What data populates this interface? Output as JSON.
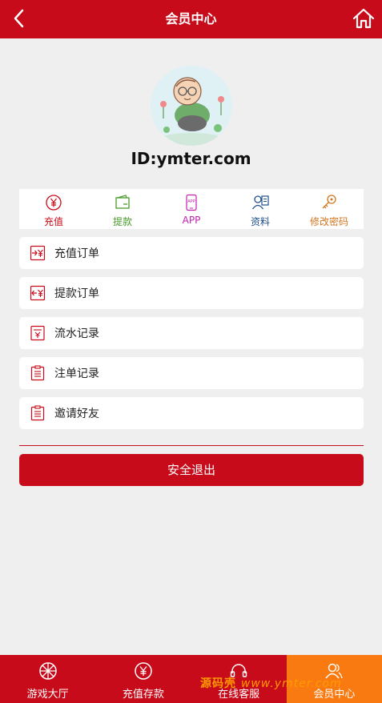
{
  "header": {
    "title": "会员中心"
  },
  "profile": {
    "id_text": "ID:ymter.com"
  },
  "quick_actions": [
    {
      "label": "充值",
      "color": "#c80b1a",
      "icon": "yen-circle-icon"
    },
    {
      "label": "提款",
      "color": "#4a9b2b",
      "icon": "wallet-icon"
    },
    {
      "label": "APP",
      "color": "#c41fb3",
      "icon": "app-icon"
    },
    {
      "label": "资料",
      "color": "#1f4f8a",
      "icon": "profile-card-icon"
    },
    {
      "label": "修改密码",
      "color": "#d1751f",
      "icon": "key-icon"
    }
  ],
  "menu": [
    {
      "label": "充值订单",
      "icon": "deposit-order-icon"
    },
    {
      "label": "提款订单",
      "icon": "withdraw-order-icon"
    },
    {
      "label": "流水记录",
      "icon": "ledger-icon"
    },
    {
      "label": "注单记录",
      "icon": "bet-record-icon"
    },
    {
      "label": "邀请好友",
      "icon": "invite-icon"
    }
  ],
  "logout_label": "安全退出",
  "tabs": [
    {
      "label": "游戏大厅",
      "icon": "wheel-icon",
      "active": false
    },
    {
      "label": "充值存款",
      "icon": "yen-circle-icon",
      "active": false
    },
    {
      "label": "在线客服",
      "icon": "headset-icon",
      "active": false
    },
    {
      "label": "会员中心",
      "icon": "users-icon",
      "active": true
    }
  ],
  "watermark": {
    "brand": "源码壳",
    "url": "www.ymter.com"
  },
  "colors": {
    "primary": "#c80b1a",
    "active_tab": "#f97a10",
    "background": "#efefef"
  }
}
